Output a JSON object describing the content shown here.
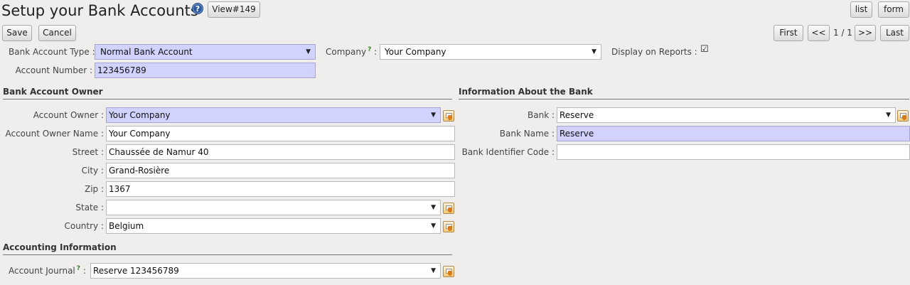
{
  "header": {
    "title": "Setup your Bank Accounts",
    "help_glyph": "?",
    "view_label": "View#149",
    "view_list": "list",
    "view_form": "form"
  },
  "toolbar": {
    "save_label": "Save",
    "cancel_label": "Cancel",
    "first_label": "First",
    "prev_label": "<<",
    "position": "1 / 1",
    "next_label": ">>",
    "last_label": "Last"
  },
  "form": {
    "bank_account_type": {
      "label": "Bank Account Type :",
      "value": "Normal Bank Account"
    },
    "company": {
      "label": "Company",
      "help": "?",
      "colon": ":",
      "value": "Your Company"
    },
    "display_on_reports": {
      "label": "Display on Reports :",
      "checked": true,
      "glyph": "☑"
    },
    "account_number": {
      "label": "Account Number :",
      "value": "123456789"
    }
  },
  "owner": {
    "section_title": "Bank Account Owner",
    "account_owner": {
      "label": "Account Owner :",
      "value": "Your Company"
    },
    "account_owner_name": {
      "label": "Account Owner Name :",
      "value": "Your Company"
    },
    "street": {
      "label": "Street :",
      "value": "Chaussée de Namur 40"
    },
    "city": {
      "label": "City :",
      "value": "Grand-Rosière"
    },
    "zip": {
      "label": "Zip :",
      "value": "1367"
    },
    "state": {
      "label": "State :",
      "value": ""
    },
    "country": {
      "label": "Country :",
      "value": "Belgium"
    }
  },
  "bank_info": {
    "section_title": "Information About the Bank",
    "bank": {
      "label": "Bank :",
      "value": "Reserve"
    },
    "bank_name": {
      "label": "Bank Name :",
      "value": "Reserve"
    },
    "bic": {
      "label": "Bank Identifier Code :",
      "value": ""
    }
  },
  "accounting": {
    "section_title": "Accounting Information",
    "journal": {
      "label": "Account Journal",
      "help": "?",
      "colon": ":",
      "value": "Reserve 123456789"
    }
  },
  "icons": {
    "dropdown_arrow": "▼",
    "search": "search-icon"
  },
  "colors": {
    "required_field": "#d2d2ff",
    "background": "#efeeed"
  }
}
